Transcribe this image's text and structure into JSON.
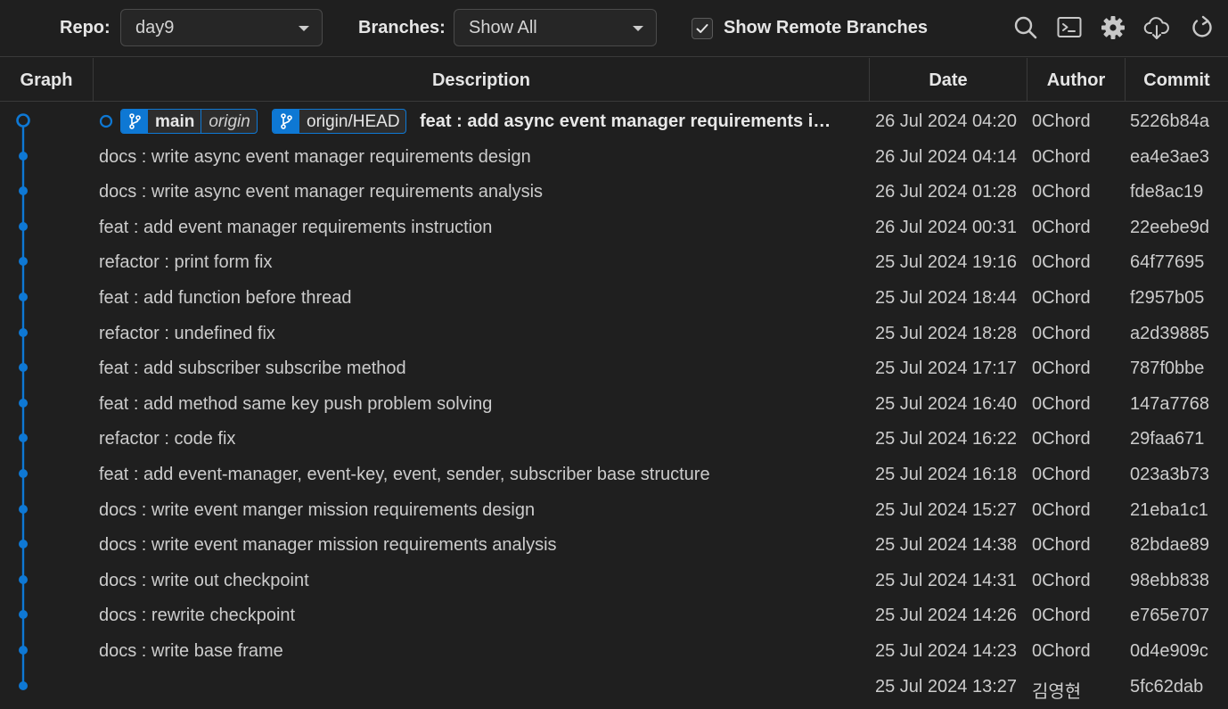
{
  "toolbar": {
    "repo_label": "Repo:",
    "repo_value": "day9",
    "branches_label": "Branches:",
    "branches_value": "Show All",
    "show_remote_label": "Show Remote Branches",
    "show_remote_checked": true,
    "icons": [
      "search-icon",
      "terminal-icon",
      "gear-icon",
      "cloud-download-icon",
      "refresh-icon"
    ]
  },
  "table": {
    "headers": {
      "graph": "Graph",
      "description": "Description",
      "date": "Date",
      "author": "Author",
      "commit": "Commit"
    }
  },
  "head_refs": {
    "local_branch": "main",
    "local_remote": "origin",
    "remote_head": "origin/HEAD"
  },
  "commits": [
    {
      "description": "feat : add async event manager requirements i…",
      "date": "26 Jul 2024 04:20",
      "author": "0Chord",
      "hash": "5226b84a"
    },
    {
      "description": "docs : write async event manager requirements design",
      "date": "26 Jul 2024 04:14",
      "author": "0Chord",
      "hash": "ea4e3ae3"
    },
    {
      "description": "docs : write async event manager requirements analysis",
      "date": "26 Jul 2024 01:28",
      "author": "0Chord",
      "hash": "fde8ac19"
    },
    {
      "description": "feat : add event manager requirements instruction",
      "date": "26 Jul 2024 00:31",
      "author": "0Chord",
      "hash": "22eebe9d"
    },
    {
      "description": "refactor : print form fix",
      "date": "25 Jul 2024 19:16",
      "author": "0Chord",
      "hash": "64f77695"
    },
    {
      "description": "feat : add function before thread",
      "date": "25 Jul 2024 18:44",
      "author": "0Chord",
      "hash": "f2957b05"
    },
    {
      "description": "refactor : undefined fix",
      "date": "25 Jul 2024 18:28",
      "author": "0Chord",
      "hash": "a2d39885"
    },
    {
      "description": "feat : add subscriber subscribe method",
      "date": "25 Jul 2024 17:17",
      "author": "0Chord",
      "hash": "787f0bbe"
    },
    {
      "description": "feat : add method same key push problem solving",
      "date": "25 Jul 2024 16:40",
      "author": "0Chord",
      "hash": "147a7768"
    },
    {
      "description": "refactor : code fix",
      "date": "25 Jul 2024 16:22",
      "author": "0Chord",
      "hash": "29faa671"
    },
    {
      "description": "feat : add event-manager, event-key, event, sender, subscriber base structure",
      "date": "25 Jul 2024 16:18",
      "author": "0Chord",
      "hash": "023a3b73"
    },
    {
      "description": "docs : write event manger mission requirements design",
      "date": "25 Jul 2024 15:27",
      "author": "0Chord",
      "hash": "21eba1c1"
    },
    {
      "description": "docs : write event manager mission requirements analysis",
      "date": "25 Jul 2024 14:38",
      "author": "0Chord",
      "hash": "82bdae89"
    },
    {
      "description": "docs : write out checkpoint",
      "date": "25 Jul 2024 14:31",
      "author": "0Chord",
      "hash": "98ebb838"
    },
    {
      "description": "docs : rewrite checkpoint",
      "date": "25 Jul 2024 14:26",
      "author": "0Chord",
      "hash": "e765e707"
    },
    {
      "description": "docs : write base frame",
      "date": "25 Jul 2024 14:23",
      "author": "0Chord",
      "hash": "0d4e909c"
    },
    {
      "description": "",
      "date": "25 Jul 2024 13:27",
      "author": "김영현",
      "hash": "5fc62dab"
    }
  ],
  "colors": {
    "graph_line": "#0e78d4",
    "badge": "#0e78d4",
    "background": "#1f1f1f"
  }
}
